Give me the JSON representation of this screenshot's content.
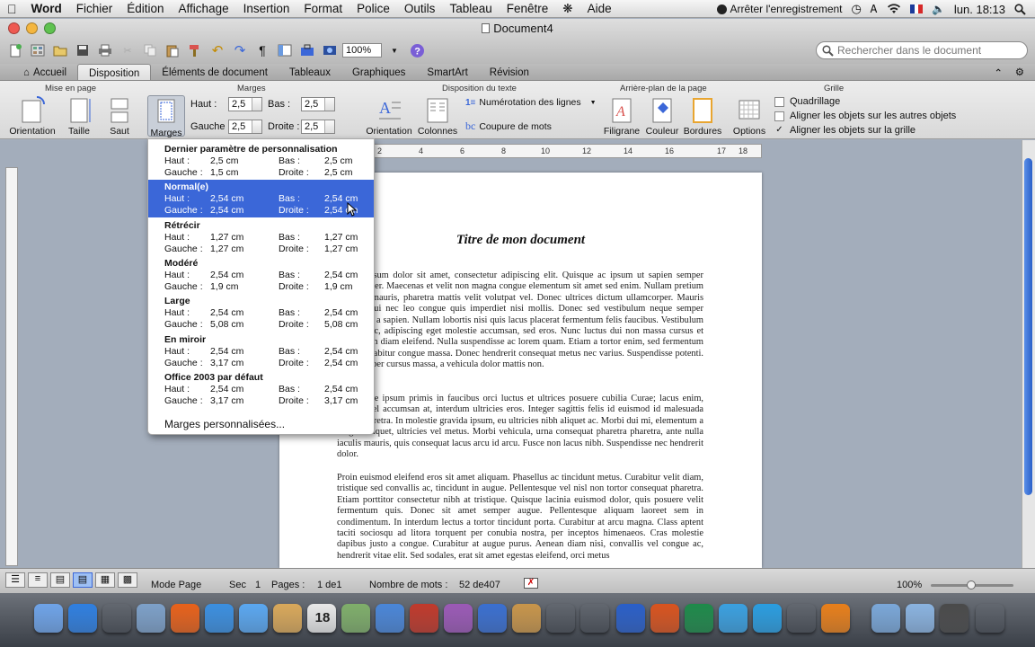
{
  "menubar": {
    "items": [
      "Word",
      "Fichier",
      "Édition",
      "Affichage",
      "Insertion",
      "Format",
      "Police",
      "Outils",
      "Tableau",
      "Fenêtre",
      "Aide"
    ],
    "recording": "Arrêter l'enregistrement",
    "clock": "lun. 18:13"
  },
  "window": {
    "title": "Document4",
    "zoom": "100%",
    "search_placeholder": "Rechercher dans le document"
  },
  "tabs": [
    "Accueil",
    "Disposition",
    "Éléments de document",
    "Tableaux",
    "Graphiques",
    "SmartArt",
    "Révision"
  ],
  "ribbon": {
    "groups": {
      "page_setup": "Mise en page",
      "margins": "Marges",
      "text_layout": "Disposition du texte",
      "background": "Arrière-plan de la page",
      "grid": "Grille"
    },
    "buttons": {
      "orientation": "Orientation",
      "size": "Taille",
      "break": "Saut",
      "margins": "Marges",
      "text_orientation": "Orientation",
      "columns": "Colonnes",
      "line_numbers": "Numérotation des lignes",
      "hyphenation": "Coupure de mots",
      "watermark": "Filigrane",
      "color": "Couleur",
      "borders": "Bordures",
      "options": "Options"
    },
    "margin_fields": {
      "top_label": "Haut :",
      "top": "2,5",
      "bottom_label": "Bas :",
      "bottom": "2,5",
      "left_label": "Gauche :",
      "left": "2,5",
      "right_label": "Droite :",
      "right": "2,5"
    },
    "grid": {
      "gridlines": "Quadrillage",
      "snap_objects": "Aligner les objets sur les autres objets",
      "snap_grid": "Aligner les objets sur la grille",
      "snap_grid_checked": "✓"
    }
  },
  "margin_menu": {
    "labels": {
      "top": "Haut :",
      "bottom": "Bas :",
      "left": "Gauche :",
      "right": "Droite :"
    },
    "presets": [
      {
        "name": "Dernier paramètre de personnalisation",
        "top": "2,5 cm",
        "bottom": "2,5 cm",
        "left": "1,5 cm",
        "right": "2,5 cm"
      },
      {
        "name": "Normal(e)",
        "top": "2,54 cm",
        "bottom": "2,54 cm",
        "left": "2,54 cm",
        "right": "2,54 cm"
      },
      {
        "name": "Rétrécir",
        "top": "1,27 cm",
        "bottom": "1,27 cm",
        "left": "1,27 cm",
        "right": "1,27 cm"
      },
      {
        "name": "Modéré",
        "top": "2,54 cm",
        "bottom": "2,54 cm",
        "left": "1,9 cm",
        "right": "1,9 cm"
      },
      {
        "name": "Large",
        "top": "2,54 cm",
        "bottom": "2,54 cm",
        "left": "5,08 cm",
        "right": "5,08 cm"
      },
      {
        "name": "En miroir",
        "top": "2,54 cm",
        "bottom": "2,54 cm",
        "left": "3,17 cm",
        "right": "2,54 cm"
      },
      {
        "name": "Office 2003 par défaut",
        "top": "2,54 cm",
        "bottom": "2,54 cm",
        "left": "3,17 cm",
        "right": "3,17 cm"
      }
    ],
    "custom": "Marges personnalisées..."
  },
  "ruler_marks": [
    "2",
    "4",
    "6",
    "8",
    "10",
    "12",
    "14",
    "16",
    "17",
    "18"
  ],
  "document": {
    "heading": "Titre de mon document",
    "paragraphs": [
      "Lorem ipsum dolor sit amet, consectetur adipiscing elit. Quisque ac ipsum ut sapien semper ullamcorper. Maecenas et velit non magna congue elementum sit amet sed enim. Nullam pretium pulvinar mauris, pharetra mattis velit volutpat vel. Donec ultrices dictum ullamcorper. Mauris gravida dui nec leo congue quis imperdiet nisi mollis. Donec sed vestibulum neque semper laoreet eu a sapien. Nullam lobortis nisi quis lacus placerat fermentum felis faucibus. Vestibulum dolor nunc, adipiscing eget molestie accumsan, sed eros. Nunc luctus dui non massa cursus et fermentum diam eleifend. Nulla suspendisse ac lorem quam. Etiam a tortor enim, sed fermentum risus. Curabitur congue massa. Donec hendrerit consequat metus nec varius. Suspendisse potenti. Ullamcorper cursus massa, a vehicula dolor mattis non.",
      "Etiam ante ipsum primis in faucibus orci luctus et ultrices posuere cubilia Curae; lacus enim, sodales vel accumsan at, interdum ultricies eros. Integer sagittis felis id euismod id malesuada quam pharetra. In molestie gravida ipsum, eu ultricies nibh aliquet ac. Morbi dui mi, elementum a feugiat aliquet, ultricies vel metus. Morbi vehicula, urna consequat pharetra pharetra, ante nulla iaculis mauris, quis consequat lacus arcu id arcu. Fusce non lacus nibh. Suspendisse nec hendrerit dolor.",
      "Proin euismod eleifend eros sit amet aliquam. Phasellus ac tincidunt metus. Curabitur velit diam, tristique sed convallis ac, tincidunt in augue. Pellentesque vel nisl non tortor consequat pharetra. Etiam porttitor consectetur nibh at tristique. Quisque lacinia euismod dolor, quis posuere velit fermentum quis. Donec sit amet semper augue. Pellentesque aliquam laoreet sem in condimentum. In interdum lectus a tortor tincidunt porta. Curabitur at arcu magna. Class aptent taciti sociosqu ad litora torquent per conubia nostra, per inceptos himenaeos. Cras molestie dapibus justo a congue. Curabitur at augue purus. Aenean diam nisi, convallis vel congue ac, hendrerit vitae elit. Sed sodales, erat sit amet egestas eleifend, orci metus"
    ]
  },
  "status": {
    "view": "Mode Page",
    "sec_label": "Sec",
    "sec": "1",
    "pages_label": "Pages :",
    "pages": "1 de1",
    "words_label": "Nombre de mots :",
    "words": "52 de407",
    "zoom": "100%"
  },
  "dock": {
    "calendar_day": "18",
    "apps": [
      "finder-icon",
      "appstore-icon",
      "dashboard-icon",
      "preview-icon",
      "firefox-icon",
      "safari-icon",
      "ichat-icon",
      "addressbook-icon",
      "ical-icon",
      "iphoto-icon",
      "itunes-icon",
      "photobooth-icon",
      "imovie-icon",
      "spaces-icon",
      "garageband-icon",
      "timemachine-icon",
      "preferences-icon",
      "word-icon",
      "powerpoint-icon",
      "excel-icon",
      "messenger-icon",
      "network-icon",
      "bluetooth-icon",
      "vlc-icon",
      "applications-folder-icon",
      "documents-folder-icon",
      "music-folder-icon",
      "trash-icon"
    ]
  }
}
